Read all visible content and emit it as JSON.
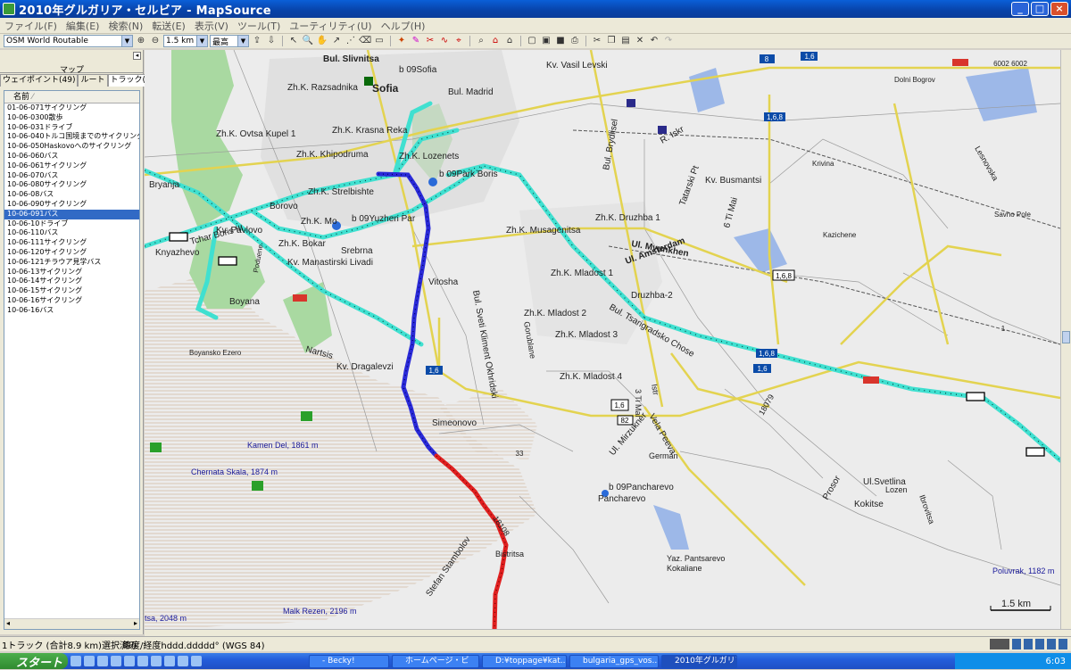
{
  "window": {
    "title": "2010年グルガリア・セルビア - MapSource"
  },
  "menus": [
    "ファイル(F)",
    "編集(E)",
    "検索(N)",
    "転送(E)",
    "表示(V)",
    "ツール(T)",
    "ユーティリティ(U)",
    "ヘルプ(H)"
  ],
  "toolbar": {
    "map_product": "OSM World Routable",
    "zoom_scale": "1.5 km",
    "detail": "最高"
  },
  "left_panel": {
    "title": "マップ",
    "tabs": [
      "ウェイポイント(49)",
      "ルート",
      "トラック(22)"
    ],
    "column_header": "名前",
    "tracks": [
      "01-06-071サイクリング",
      "10-06-0300散歩",
      "10-06-031ドライブ",
      "10-06-040トルコ国境までのサイクリング",
      "10-06-050Haskovoへのサイクリング",
      "10-06-060バス",
      "10-06-061サイクリング",
      "10-06-070バス",
      "10-06-080サイクリング",
      "10-06-08バス",
      "10-06-090サイクリング",
      "10-06-091バス",
      "10-06-10ドライブ",
      "10-06-110バス",
      "10-06-111サイクリング",
      "10-06-120サイクリング",
      "10-06-121チラウア見学バス",
      "10-06-13サイクリング",
      "10-06-14サイクリング",
      "10-06-15サイクリング",
      "10-06-16サイクリング",
      "10-06-16バス"
    ],
    "selected_index": 11
  },
  "map": {
    "labels": [
      "Bul. Slivnitsa",
      "b 09Sofia",
      "Sofia",
      "Zh.K. Razsadnika",
      "Bul. Madrid",
      "Kv. Vasil Levski",
      "Zh.K. Ovtsa Kupel 1",
      "Zh.K. Krasna Reka",
      "Zh.K. Khipodruma",
      "Zh.K. Lozenets",
      "b 09Park Boris",
      "Zh.K. Strelbishte",
      "Zh.K. Mo",
      "b 09Yuzhen Par",
      "Kv. Pavlovo",
      "Zh.K. Bokar",
      "Srebrna",
      "Kv. Manastirski Livadi",
      "Vitosha",
      "Knyazhevo",
      "Boyana",
      "Boyansko Ezero",
      "Kv. Dragalevzi",
      "Nartsis",
      "Simeonovo",
      "Zh.K. Musagenitsa",
      "Zh.K. Druzhba 1",
      "Kv. Busmantsi",
      "Ul. Myunkhen",
      "Ul. Amsterdam",
      "Zh.K. Mladost 1",
      "Druzhba-2",
      "Zh.K. Mladost 2",
      "Zh.K. Mladost 3",
      "Zh.K. Mladost 4",
      "Bul. Tsarigradsko Chose",
      "German",
      "b 09Pancharevo",
      "Pancharevo",
      "Yaz. Pantsarevo",
      "Kokaliane",
      "Ul.Svetlina",
      "Lozen",
      "Kokitse",
      "Prosor",
      "Kamen Del, 1861 m",
      "Chernata Skala, 1874 m",
      "Malk Rezen, 2196 m",
      "Poluvrak, 1182 m",
      "Stefan Stambolov",
      "Bistritsa",
      "Dolni Bogrov",
      "Krivina",
      "Kazichene",
      "Bul. Brydlisel",
      "R. Iskr",
      "Tatarski Pt",
      "6 Ti Mai",
      "Ul. Mirzukner",
      "Vela Peeva",
      "Bul. Sveti Kliment Okhridski",
      "18079",
      "18108",
      "Lesnovska",
      "Ibrovitsa",
      "Gorublane",
      "Tchar Boris III",
      "Bryanja",
      "Savno Pole",
      "Poduene",
      "Borovo",
      "3 Ti Mai",
      "Istr",
      "tsa, 2048 m"
    ],
    "road_numbers": [
      "8",
      "1,6",
      "1,6,8",
      "1,6,8",
      "1,6",
      "82",
      "1,6",
      "33",
      "1,6,8",
      "1,6",
      "1"
    ],
    "route_number": "6002 6002",
    "scale": "1.5 km"
  },
  "status": {
    "selection": "1トラック (合計8.9 km)選択済み",
    "coords": "緯度/経度hddd.ddddd°  (WGS 84)"
  },
  "taskbar": {
    "start": "スタート",
    "tasks": [
      "- Becky!",
      "ホームページ・ビ",
      "D:¥toppage¥kat...",
      "bulgaria_gps_vos...",
      "2010年グルガリア..."
    ],
    "clock": "6:03"
  },
  "colors": {
    "titlebar": "#0a5fd8",
    "selected_row": "#316ac5",
    "track_cyan": "#40e0d0",
    "track_blue": "#2a2ad8",
    "track_red": "#e02020",
    "major_road": "#f3e65a"
  }
}
